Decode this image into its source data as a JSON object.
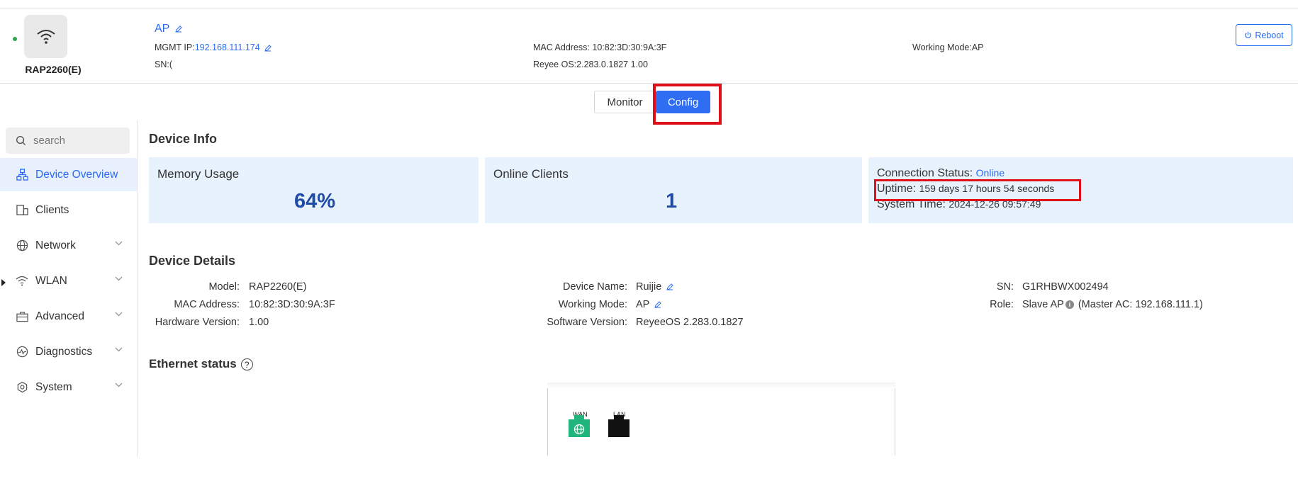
{
  "device": {
    "model_label": "RAP2260(E)",
    "name_link": "AP",
    "mgmt_ip_label": "MGMT IP:",
    "mgmt_ip": "192.168.111.174",
    "sn_label": "SN:",
    "sn_value": "(",
    "mac_text": "MAC Address: 10:82:3D:30:9A:3F",
    "os_text": "Reyee OS:2.283.0.1827 1.00",
    "working_mode_text": "Working Mode:AP",
    "status_color": "#2ea44f"
  },
  "actions": {
    "reboot_label": "Reboot"
  },
  "tabs": [
    {
      "label": "Monitor",
      "active": false
    },
    {
      "label": "Config",
      "active": true
    }
  ],
  "sidebar": {
    "search_placeholder": "search",
    "items": [
      {
        "label": "Device Overview",
        "icon": "topology-icon",
        "active": true
      },
      {
        "label": "Clients",
        "icon": "clients-icon",
        "active": false
      },
      {
        "label": "Network",
        "icon": "globe-icon",
        "active": false,
        "expandable": true
      },
      {
        "label": "WLAN",
        "icon": "wifi-icon",
        "active": false,
        "expandable": true
      },
      {
        "label": "Advanced",
        "icon": "toolbox-icon",
        "active": false,
        "expandable": true
      },
      {
        "label": "Diagnostics",
        "icon": "pulse-icon",
        "active": false,
        "expandable": true
      },
      {
        "label": "System",
        "icon": "gear-icon",
        "active": false,
        "expandable": true
      }
    ]
  },
  "device_info": {
    "title": "Device Info",
    "memory": {
      "label": "Memory Usage",
      "value": "64%"
    },
    "clients": {
      "label": "Online Clients",
      "value": "1"
    },
    "connection_label": "Connection Status:",
    "connection_value": "Online",
    "uptime_label": "Uptime:",
    "uptime_value": "159 days 17 hours 54 seconds",
    "system_time_label": "System Time:",
    "system_time_value": "2024-12-26 09:57:49"
  },
  "device_details": {
    "title": "Device Details",
    "model_label": "Model:",
    "model_value": "RAP2260(E)",
    "mac_label": "MAC Address:",
    "mac_value": "10:82:3D:30:9A:3F",
    "hw_label": "Hardware Version:",
    "hw_value": "1.00",
    "name_label": "Device Name:",
    "name_value": "Ruijie",
    "mode_label": "Working Mode:",
    "mode_value": "AP",
    "sw_label": "Software Version:",
    "sw_value": "ReyeeOS 2.283.0.1827",
    "sn_label": "SN:",
    "sn_value": "G1RHBWX002494",
    "role_label": "Role:",
    "role_value": "Slave AP",
    "master_text": "(Master AC:  192.168.111.1)"
  },
  "ethernet": {
    "title": "Ethernet status",
    "ports": [
      {
        "label": "WAN",
        "color": "#1fb57c"
      },
      {
        "label": "LAN",
        "color": "#111111"
      }
    ]
  }
}
